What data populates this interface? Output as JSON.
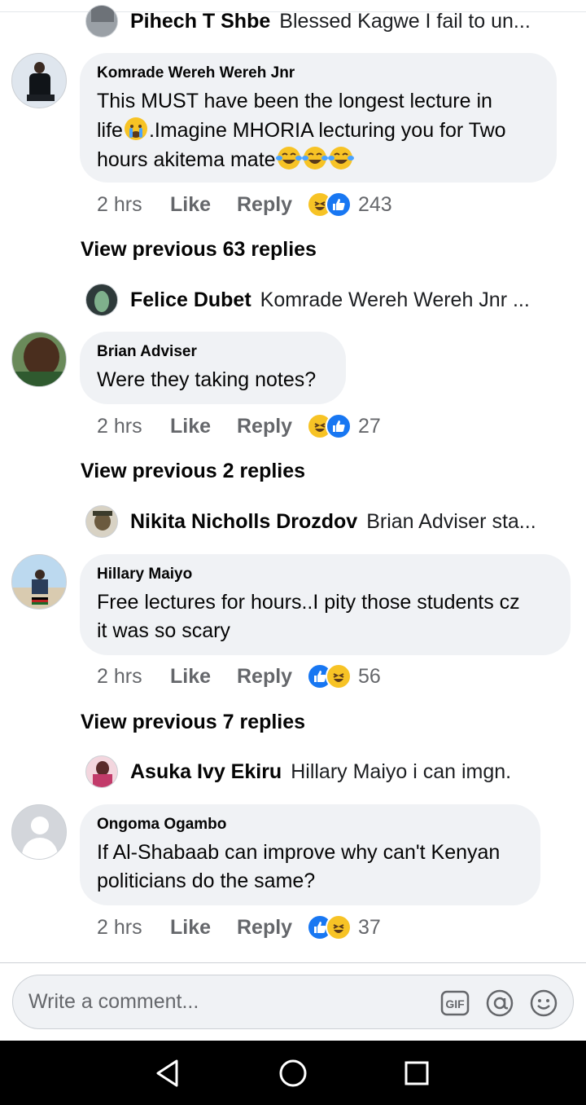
{
  "threads": [
    {
      "preview": {
        "name": "Pihech T Shbe",
        "text": "Blessed Kagwe I fail to un..."
      },
      "comment": {
        "author": "Komrade Wereh Wereh Jnr",
        "text_line1": "This MUST have been the longest lecture in",
        "text_line2a": "life",
        "text_line2b": ".Imagine MHORIA lecturing you for Two",
        "text_line3": "hours akitema mate",
        "time": "2 hrs",
        "like": "Like",
        "reply": "Reply",
        "reactions": [
          "haha",
          "like"
        ],
        "reaction_count": "243"
      }
    },
    {
      "view_previous": "View previous 63 replies",
      "preview": {
        "name": "Felice Dubet",
        "text": "Komrade Wereh Wereh Jnr ..."
      },
      "comment": {
        "author": "Brian Adviser",
        "text_line1": "Were they taking notes?",
        "time": "2 hrs",
        "like": "Like",
        "reply": "Reply",
        "reactions": [
          "haha",
          "like"
        ],
        "reaction_count": "27"
      }
    },
    {
      "view_previous": "View previous 2 replies",
      "preview": {
        "name": "Nikita Nicholls Drozdov",
        "text": "Brian Adviser sta..."
      },
      "comment": {
        "author": "Hillary Maiyo",
        "text_line1": "Free lectures for hours..I pity those students cz",
        "text_line2": "it was so scary",
        "time": "2 hrs",
        "like": "Like",
        "reply": "Reply",
        "reactions": [
          "like",
          "haha"
        ],
        "reaction_count": "56"
      }
    },
    {
      "view_previous": "View previous 7 replies",
      "preview": {
        "name": "Asuka Ivy Ekiru",
        "text": "Hillary Maiyo i can imgn."
      },
      "comment": {
        "author": "Ongoma Ogambo",
        "text_line1": "If Al-Shabaab can improve why can't Kenyan",
        "text_line2": "politicians do the same?",
        "time": "2 hrs",
        "like": "Like",
        "reply": "Reply",
        "reactions": [
          "like",
          "haha"
        ],
        "reaction_count": "37"
      }
    }
  ],
  "composer": {
    "placeholder": "Write a comment...",
    "icons": [
      "gif-icon",
      "mention-icon",
      "emoji-icon"
    ]
  },
  "navbar": {
    "icons": [
      "back-icon",
      "home-icon",
      "recents-icon"
    ]
  },
  "colors": {
    "bubble": "#f0f2f5",
    "like_blue": "#1877f2",
    "haha_yellow": "#f7c325",
    "meta_gray": "#65676b"
  }
}
